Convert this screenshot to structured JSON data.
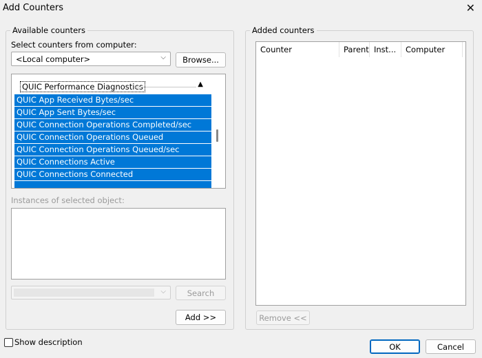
{
  "window": {
    "title": "Add Counters",
    "close_glyph": "✕"
  },
  "available": {
    "legend": "Available counters",
    "select_label": "Select counters from computer:",
    "computer_value": "<Local computer>",
    "browse_label": "Browse...",
    "category": "QUIC Performance Diagnostics",
    "counters": [
      "QUIC App Received Bytes/sec",
      "QUIC App Sent Bytes/sec",
      "QUIC Connection Operations Completed/sec",
      "QUIC Connection Operations Queued",
      "QUIC Connection Operations Queued/sec",
      "QUIC Connections Active",
      "QUIC Connections Connected"
    ],
    "instances_label": "Instances of selected object:",
    "search_label": "Search",
    "add_label": "Add >>"
  },
  "added": {
    "legend": "Added counters",
    "columns": [
      "Counter",
      "Parent",
      "Inst...",
      "Computer"
    ],
    "remove_label": "Remove <<"
  },
  "footer": {
    "show_description": "Show description",
    "ok_label": "OK",
    "cancel_label": "Cancel"
  }
}
